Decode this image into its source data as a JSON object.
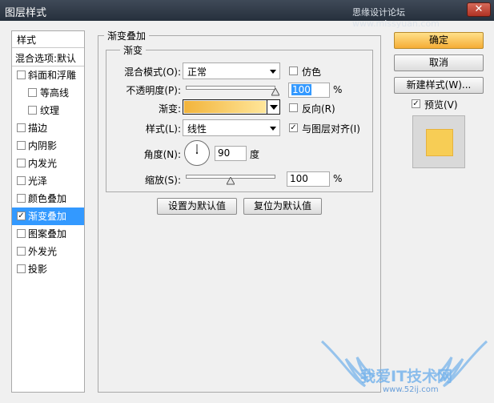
{
  "window": {
    "title": "图层样式",
    "watermark": "思缘设计论坛 www.missyuan.com",
    "close_glyph": "✕"
  },
  "left_panel": {
    "header": "样式",
    "blend_options": "混合选项:默认",
    "items": [
      {
        "label": "斜面和浮雕",
        "checked": false,
        "sub": false,
        "selected": false
      },
      {
        "label": "等高线",
        "checked": false,
        "sub": true,
        "selected": false
      },
      {
        "label": "纹理",
        "checked": false,
        "sub": true,
        "selected": false
      },
      {
        "label": "描边",
        "checked": false,
        "sub": false,
        "selected": false
      },
      {
        "label": "内阴影",
        "checked": false,
        "sub": false,
        "selected": false
      },
      {
        "label": "内发光",
        "checked": false,
        "sub": false,
        "selected": false
      },
      {
        "label": "光泽",
        "checked": false,
        "sub": false,
        "selected": false
      },
      {
        "label": "颜色叠加",
        "checked": false,
        "sub": false,
        "selected": false
      },
      {
        "label": "渐变叠加",
        "checked": true,
        "sub": false,
        "selected": true
      },
      {
        "label": "图案叠加",
        "checked": false,
        "sub": false,
        "selected": false
      },
      {
        "label": "外发光",
        "checked": false,
        "sub": false,
        "selected": false
      },
      {
        "label": "投影",
        "checked": false,
        "sub": false,
        "selected": false
      }
    ]
  },
  "gradient_overlay": {
    "group_title": "渐变叠加",
    "subgroup_title": "渐变",
    "blend_mode_label": "混合模式(O):",
    "blend_mode_value": "正常",
    "dither_label": "仿色",
    "dither_checked": false,
    "opacity_label": "不透明度(P):",
    "opacity_value": "100",
    "opacity_fraction": 1.0,
    "opacity_unit": "%",
    "gradient_label": "渐变:",
    "gradient_colors": [
      "#f2b43b",
      "#ffe69a"
    ],
    "reverse_label": "反向(R)",
    "reverse_checked": false,
    "style_label": "样式(L):",
    "style_value": "线性",
    "align_label": "与图层对齐(I)",
    "align_checked": true,
    "angle_label": "角度(N):",
    "angle_value": "90",
    "angle_unit": "度",
    "scale_label": "缩放(S):",
    "scale_value": "100",
    "scale_fraction": 0.5,
    "scale_unit": "%",
    "make_default_label": "设置为默认值",
    "reset_default_label": "复位为默认值"
  },
  "right_panel": {
    "ok_label": "确定",
    "cancel_label": "取消",
    "new_style_label": "新建样式(W)...",
    "preview_label": "预览(V)",
    "preview_checked": true,
    "preview_color": "#f7cd55"
  },
  "site_watermark": {
    "text": "我爱IT技术网",
    "url": "www.52ij.com"
  }
}
